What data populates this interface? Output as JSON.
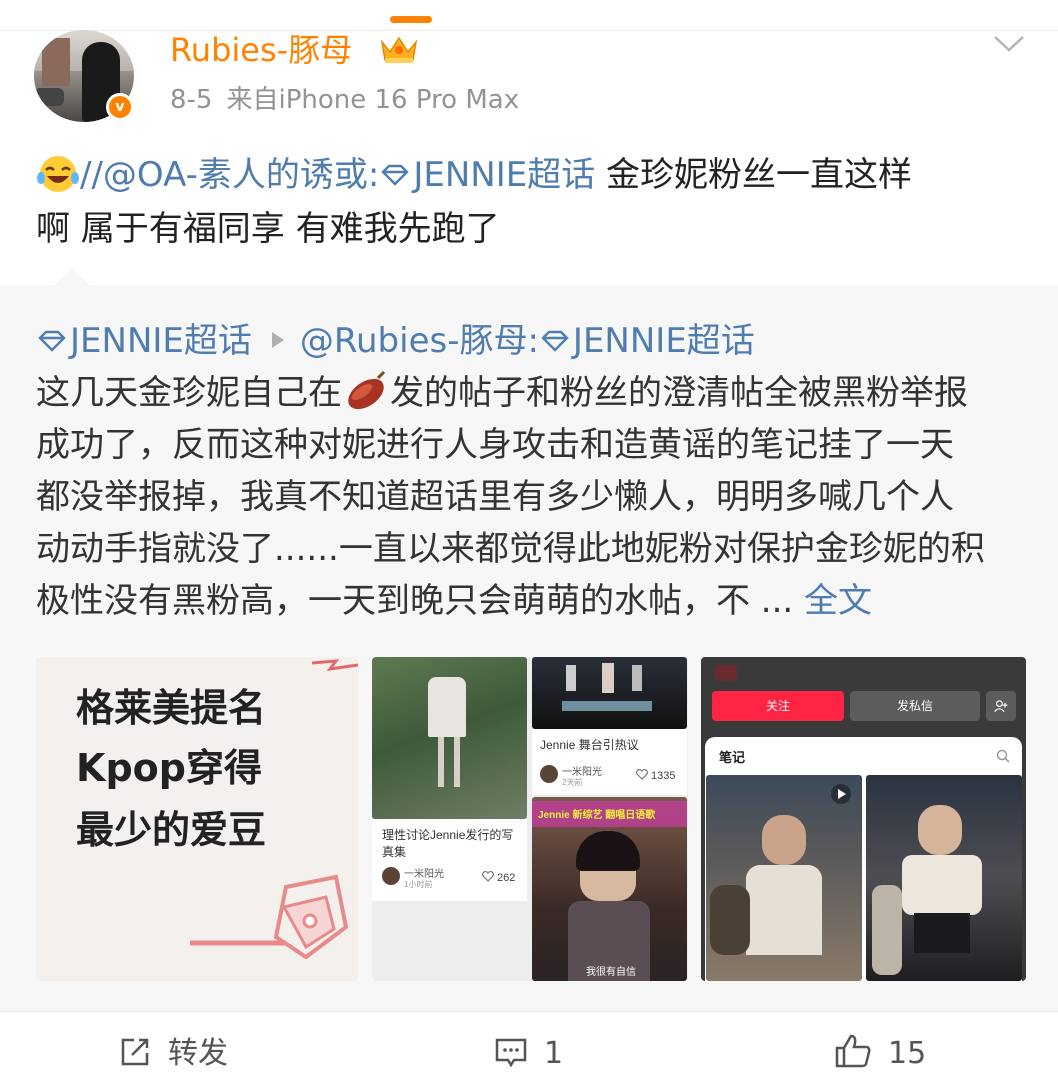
{
  "post": {
    "username": "Rubies-豚母",
    "date": "8-5",
    "source": "来自iPhone 16 Pro Max",
    "text_prefix": "//",
    "mention": "@OA-素人的诱或:",
    "topic": "JENNIE超话",
    "text_line1_rest": " 金珍妮粉丝一直这样",
    "text_line2": "啊  属于有福同享 有难我先跑了"
  },
  "repost": {
    "topic": "JENNIE超话",
    "author": "@Rubies-豚母:",
    "topic2": "JENNIE超话",
    "body_line1_a": "这几天金珍妮自己在",
    "body_line1_b": "发的帖子和粉丝的澄清帖全被黑粉举报",
    "body_line2": "成功了，反而这种对妮进行人身攻击和造黄谣的笔记挂了一天",
    "body_line3": "都没举报掉，我真不知道超话里有多少懒人，明明多喊几个人",
    "body_line4": "动动手指就没了......一直以来都觉得此地妮粉对保护金珍妮的积",
    "body_line5": "极性没有黑粉高，一天到晚只会萌萌的水帖，不 ...",
    "full_text": "全文"
  },
  "images": {
    "tile1": {
      "line1": "格莱美提名",
      "line2": "Kpop穿得",
      "line3": "最少的爱豆"
    },
    "tile2": {
      "card1_title": "理性讨论Jennie发行的写真集",
      "card1_user": "一米阳光",
      "card1_time": "1小时前",
      "card1_likes": "262",
      "card2_title": "Jennie 舞台引热议",
      "card2_user": "一米阳光",
      "card2_time": "2天前",
      "card2_likes": "1335",
      "card3_banner": "Jennie 新综艺 翻唱日语歌",
      "card3_caption": "我很有自信"
    },
    "tile3": {
      "follow": "关注",
      "message": "发私信",
      "notes": "笔记"
    }
  },
  "actions": {
    "repost_label": "转发",
    "comment_count": "1",
    "like_count": "15"
  },
  "colors": {
    "accent": "#ff8200",
    "link": "#507daf",
    "xhs_red": "#ff2442"
  }
}
